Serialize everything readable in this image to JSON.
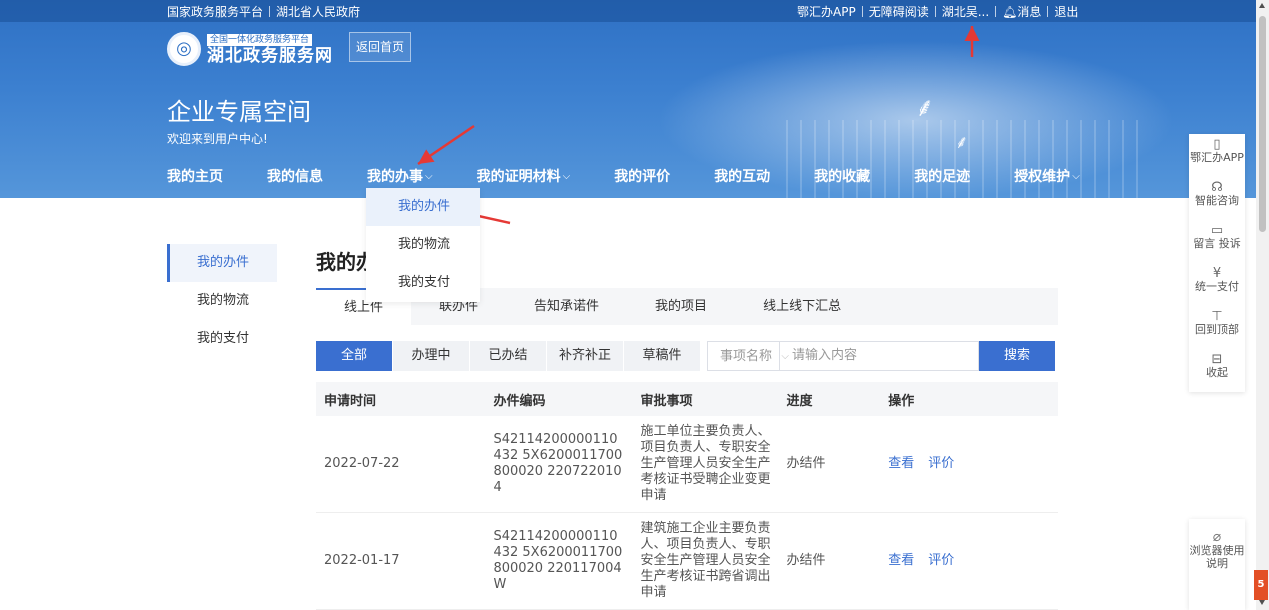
{
  "topbar": {
    "left_links": [
      "国家政务服务平台",
      "湖北省人民政府"
    ],
    "right_links": [
      "鄂汇办APP",
      "无障碍阅读",
      "湖北吴..."
    ],
    "messages": "消息",
    "logout": "退出"
  },
  "logo": {
    "subtitle": "全国一体化政务服务平台",
    "title": "湖北政务服务网"
  },
  "home_button": "返回首页",
  "page_title": "企业专属空间",
  "welcome": "欢迎来到用户中心!",
  "nav": [
    {
      "label": "我的主页",
      "dropdown": false
    },
    {
      "label": "我的信息",
      "dropdown": false
    },
    {
      "label": "我的办事",
      "dropdown": true
    },
    {
      "label": "我的证明材料",
      "dropdown": true
    },
    {
      "label": "我的评价",
      "dropdown": false
    },
    {
      "label": "我的互动",
      "dropdown": false
    },
    {
      "label": "我的收藏",
      "dropdown": false
    },
    {
      "label": "我的足迹",
      "dropdown": false
    },
    {
      "label": "授权维护",
      "dropdown": true
    }
  ],
  "dropdown_items": [
    "我的办件",
    "我的物流",
    "我的支付"
  ],
  "sidebar": [
    "我的办件",
    "我的物流",
    "我的支付"
  ],
  "main_title": "我的办件",
  "tabs": [
    "线上件",
    "联办件",
    "告知承诺件",
    "我的项目",
    "线上线下汇总"
  ],
  "filters": [
    "全部",
    "办理中",
    "已办结",
    "补齐补正",
    "草稿件"
  ],
  "search": {
    "select_label": "事项名称",
    "placeholder": "请输入内容",
    "button": "搜索"
  },
  "table": {
    "headers": [
      "申请时间",
      "办件编码",
      "审批事项",
      "进度",
      "操作"
    ],
    "rows": [
      {
        "date": "2022-07-22",
        "code": "S42114200000110432 5X6200011700800020 2207220104",
        "item": "施工单位主要负责人、项目负责人、专职安全生产管理人员安全生产考核证书受聘企业变更申请",
        "status": "办结件",
        "actions": [
          "查看",
          "评价"
        ]
      },
      {
        "date": "2022-01-17",
        "code": "S42114200000110432 5X6200011700800020 220117004W",
        "item": "建筑施工企业主要负责人、项目负责人、专职安全生产管理人员安全生产考核证书跨省调出申请",
        "status": "办结件",
        "actions": [
          "查看",
          "评价"
        ]
      }
    ]
  },
  "float_bar": [
    {
      "icon": "phone-icon",
      "glyph": "▯",
      "label": "鄂汇办APP"
    },
    {
      "icon": "headset-icon",
      "glyph": "☊",
      "label": "智能咨询"
    },
    {
      "icon": "comment-icon",
      "glyph": "▭",
      "label": "留言 投诉"
    },
    {
      "icon": "yen-icon",
      "glyph": "¥",
      "label": "统一支付"
    },
    {
      "icon": "top-icon",
      "glyph": "⊤",
      "label": "回到顶部"
    },
    {
      "icon": "collapse-icon",
      "glyph": "⊟",
      "label": "收起"
    }
  ],
  "browser_guide": "浏览器使用说明",
  "colors": {
    "accent": "#3a6fd0",
    "banner": "#2e70c4",
    "annotation_arrow": "#e53935"
  }
}
